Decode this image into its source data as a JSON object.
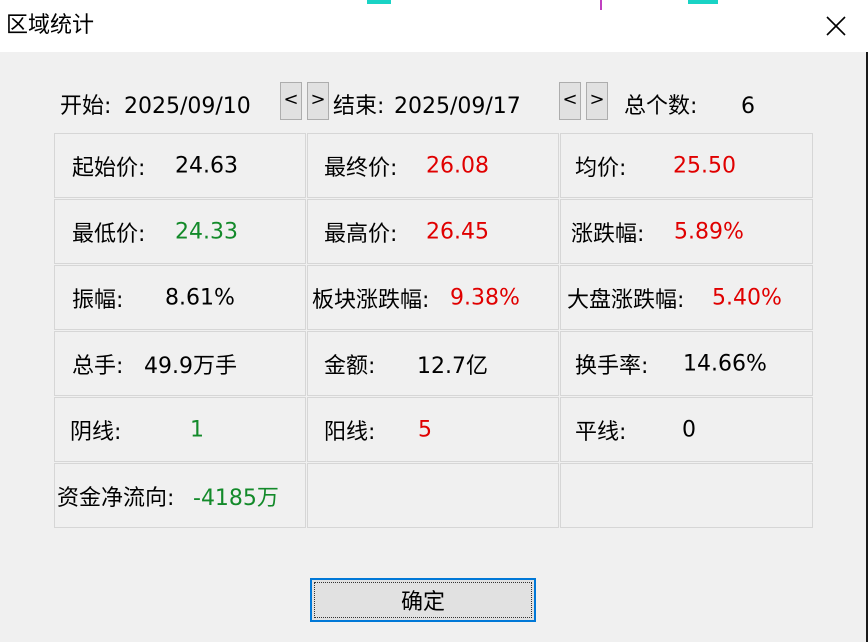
{
  "window": {
    "title": "区域统计"
  },
  "header": {
    "start_label": "开始:",
    "start_date": "2025/09/10",
    "end_label": "结束:",
    "end_date": "2025/09/17",
    "prev_label": "<",
    "next_label": ">",
    "total_label": "总个数:",
    "total_value": "6"
  },
  "stats": [
    {
      "label": "起始价:",
      "value": "24.63",
      "color": "#000000"
    },
    {
      "label": "最终价:",
      "value": "26.08",
      "color": "#e00000"
    },
    {
      "label": "均价:",
      "value": "25.50",
      "color": "#e00000"
    },
    {
      "label": "最低价:",
      "value": "24.33",
      "color": "#138a2a"
    },
    {
      "label": "最高价:",
      "value": "26.45",
      "color": "#e00000"
    },
    {
      "label": "涨跌幅:",
      "value": "5.89%",
      "color": "#e00000"
    },
    {
      "label": "振幅:",
      "value": "8.61%",
      "color": "#000000"
    },
    {
      "label": "板块涨跌幅:",
      "value": "9.38%",
      "color": "#e00000"
    },
    {
      "label": "大盘涨跌幅:",
      "value": "5.40%",
      "color": "#e00000"
    },
    {
      "label": "总手:",
      "value": "49.9万手",
      "color": "#000000"
    },
    {
      "label": "金额:",
      "value": "12.7亿",
      "color": "#000000"
    },
    {
      "label": "换手率:",
      "value": "14.66%",
      "color": "#000000"
    },
    {
      "label": "阴线:",
      "value": "1",
      "color": "#138a2a"
    },
    {
      "label": "阳线:",
      "value": "5",
      "color": "#e00000"
    },
    {
      "label": "平线:",
      "value": "0",
      "color": "#000000"
    },
    {
      "label": "资金净流向:",
      "value": "-4185万",
      "color": "#138a2a"
    }
  ],
  "buttons": {
    "ok_label": "确定"
  },
  "icons": {
    "close": "close-icon"
  }
}
